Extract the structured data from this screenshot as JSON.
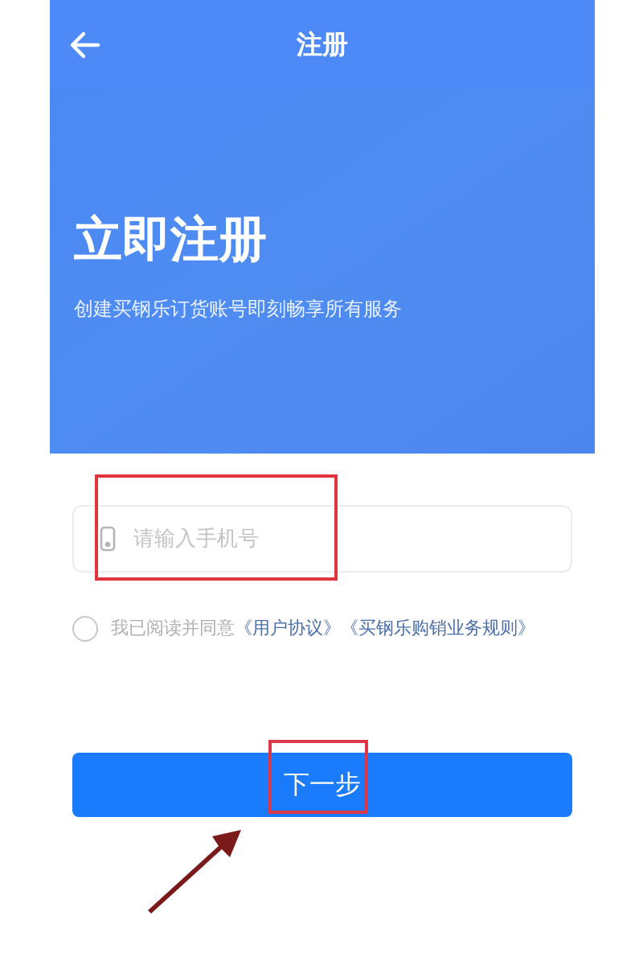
{
  "header": {
    "title": "注册"
  },
  "hero": {
    "title": "立即注册",
    "subtitle": "创建买钢乐订货账号即刻畅享所有服务"
  },
  "phone_field": {
    "placeholder": "请输入手机号"
  },
  "agreement": {
    "checked": false,
    "text": "我已阅读并同意",
    "links": [
      "《用户协议》",
      "《买钢乐购销业务规则》"
    ]
  },
  "next_button": {
    "label": "下一步"
  }
}
